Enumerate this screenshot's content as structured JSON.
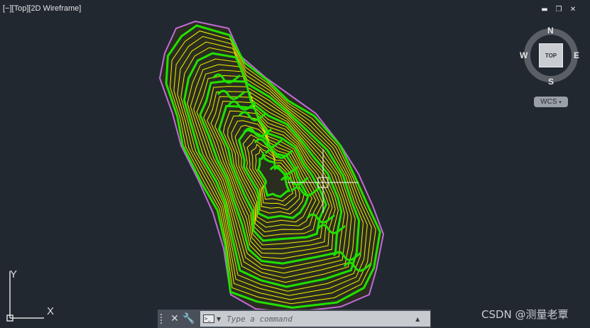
{
  "viewport": {
    "label": "[−][Top][2D Wireframe]"
  },
  "window_controls": {
    "minimize": "▬",
    "restore": "❐",
    "close": "✕"
  },
  "viewcube": {
    "north": "N",
    "south": "S",
    "east": "E",
    "west": "W",
    "face": "TOP",
    "coord_system": "WCS"
  },
  "ucs": {
    "y": "Y",
    "x": "X"
  },
  "command_line": {
    "placeholder": "Type a command",
    "close": "✕",
    "customize": "🔧"
  },
  "watermark": "CSDN @测量老覃",
  "colors": {
    "background": "#212830",
    "contour_index": "#22e000",
    "contour_minor": "#f5f000",
    "boundary": "#c36ad8",
    "crosshair": "#ffffff"
  }
}
